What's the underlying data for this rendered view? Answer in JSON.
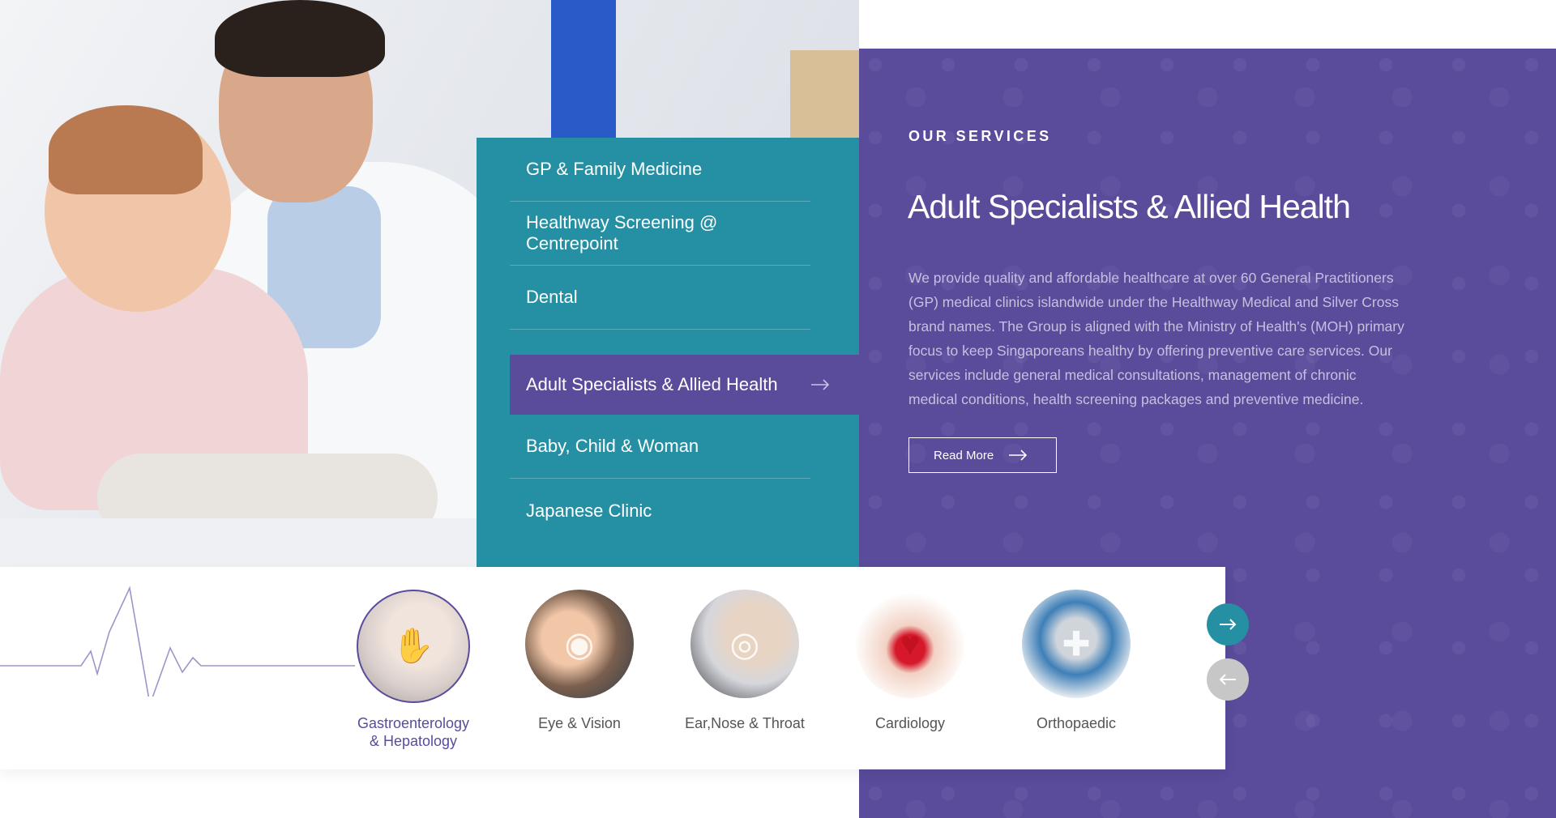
{
  "services_section": {
    "eyebrow": "OUR SERVICES",
    "title": "Adult Specialists & Allied Health",
    "description": "We provide quality and affordable healthcare at over 60 General Practitioners (GP) medical clinics islandwide under the Healthway Medical and Silver Cross brand names. The Group is aligned with the Ministry of Health's (MOH) primary focus to keep Singaporeans healthy by offering preventive care services. Our services include general medical consultations, management of chronic medical conditions, health screening packages and preventive medicine.",
    "read_more_label": "Read More"
  },
  "menu": {
    "items": [
      {
        "label": "GP & Family Medicine"
      },
      {
        "label": "Healthway Screening @ Centrepoint"
      },
      {
        "label": "Dental"
      },
      {
        "label": "Adult Specialists & Allied Health",
        "active": true
      },
      {
        "label": "Baby, Child & Woman"
      },
      {
        "label": "Japanese Clinic"
      }
    ]
  },
  "specialties": [
    {
      "label_line1": "Gastroenterology",
      "label_line2": "& Hepatology",
      "active": true
    },
    {
      "label_line1": "Eye & Vision"
    },
    {
      "label_line1": "Ear,Nose & Throat"
    },
    {
      "label_line1": "Cardiology"
    },
    {
      "label_line1": "Orthopaedic"
    }
  ],
  "icons": {
    "arrow_right": "arrow-right-icon",
    "arrow_left": "arrow-left-icon"
  },
  "colors": {
    "purple": "#5a4b9b",
    "teal": "#2590a3",
    "ecg_line": "#9d95c9"
  }
}
